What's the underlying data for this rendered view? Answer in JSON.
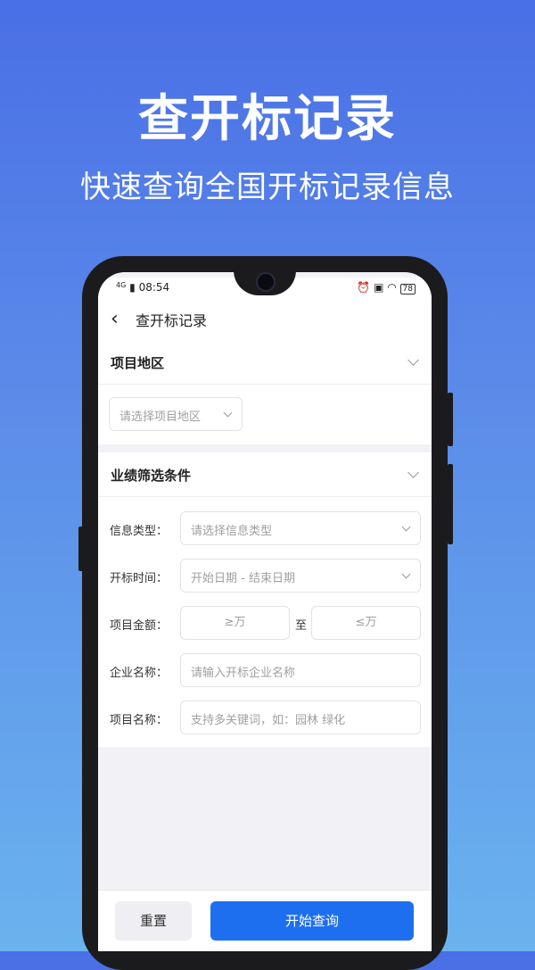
{
  "promo": {
    "title": "查开标记录",
    "subtitle": "快速查询全国开标记录信息"
  },
  "status_bar": {
    "network": "4G",
    "time": "08:54",
    "icons": [
      "alarm-icon",
      "vibrate-icon",
      "wifi-icon",
      "battery-icon"
    ],
    "battery": "78"
  },
  "navbar": {
    "back_icon": "‹",
    "title": "查开标记录"
  },
  "region_section": {
    "label": "项目地区",
    "select_placeholder": "请选择项目地区"
  },
  "filter_section": {
    "label": "业绩筛选条件",
    "info_type": {
      "label": "信息类型：",
      "placeholder": "请选择信息类型"
    },
    "bid_time": {
      "label": "开标时间：",
      "placeholder": "开始日期 - 结束日期"
    },
    "amount": {
      "label": "项目金额：",
      "min_placeholder": "≥万",
      "to": "至",
      "max_placeholder": "≤万"
    },
    "company": {
      "label": "企业名称：",
      "placeholder": "请输入开标企业名称"
    },
    "project": {
      "label": "项目名称：",
      "placeholder": "支持多关键词，如：园林 绿化"
    }
  },
  "actions": {
    "reset": "重置",
    "query": "开始查询"
  },
  "colors": {
    "primary": "#1e6ff0",
    "background_top": "#4a6fe6",
    "background_bottom": "#6ab3ee"
  }
}
